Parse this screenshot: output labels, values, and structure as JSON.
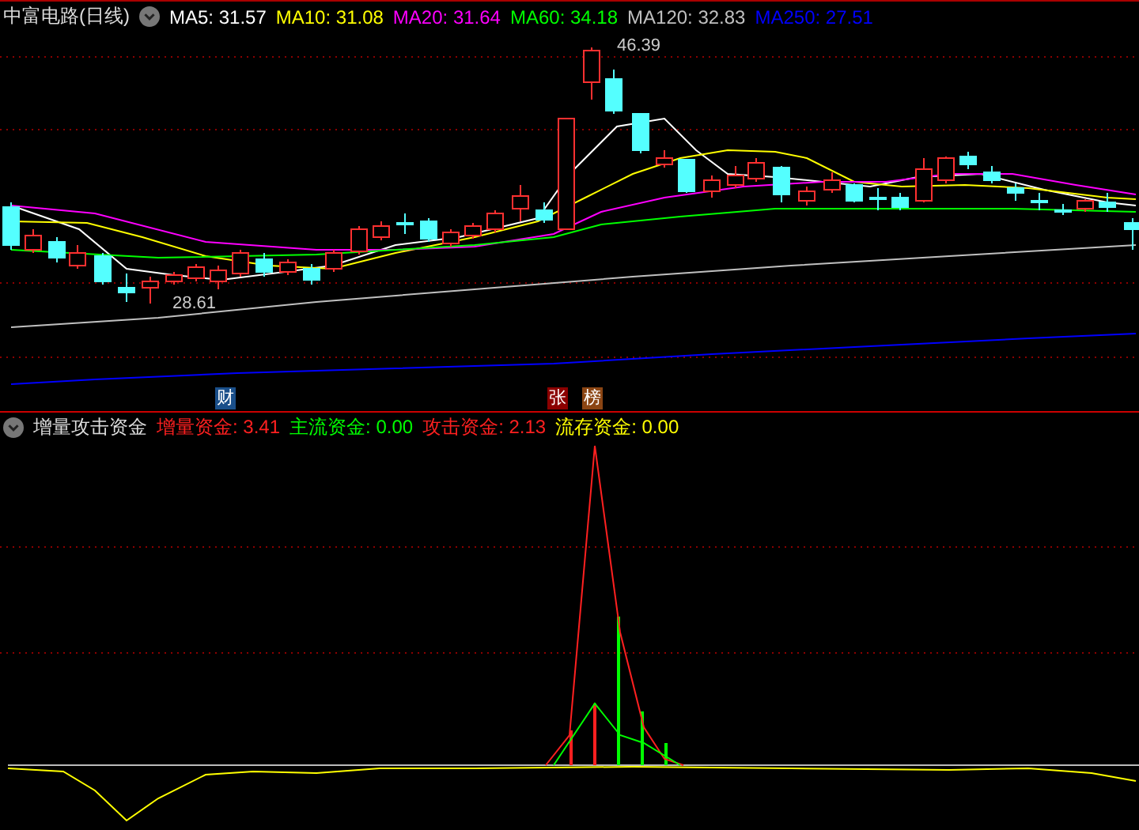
{
  "main_panel": {
    "title": "中富电路(日线)",
    "moving_averages": [
      {
        "text": "MA5: 31.57",
        "color": "#ffffff"
      },
      {
        "text": "MA10: 31.08",
        "color": "#ffff00"
      },
      {
        "text": "MA20: 31.64",
        "color": "#ff00ff"
      },
      {
        "text": "MA60: 34.18",
        "color": "#00ff00"
      },
      {
        "text": "MA120: 32.83",
        "color": "#c0c0c0"
      },
      {
        "text": "MA250: 27.51",
        "color": "#0000ff"
      }
    ],
    "high_label": "46.39",
    "low_label": "28.61"
  },
  "event_markers": [
    {
      "text": "财",
      "color": "#1a4f8a"
    },
    {
      "text": "张",
      "color": "#8b0000"
    },
    {
      "text": "榜",
      "color": "#8b4513"
    }
  ],
  "indicator_panel": {
    "title": "增量攻击资金",
    "values": [
      {
        "text": "增量资金: 3.41",
        "color": "#ff2020"
      },
      {
        "text": "主流资金: 0.00",
        "color": "#00ff00"
      },
      {
        "text": "攻击资金: 2.13",
        "color": "#ff2020"
      },
      {
        "text": "流存资金: 0.00",
        "color": "#ffff00"
      }
    ]
  }
}
